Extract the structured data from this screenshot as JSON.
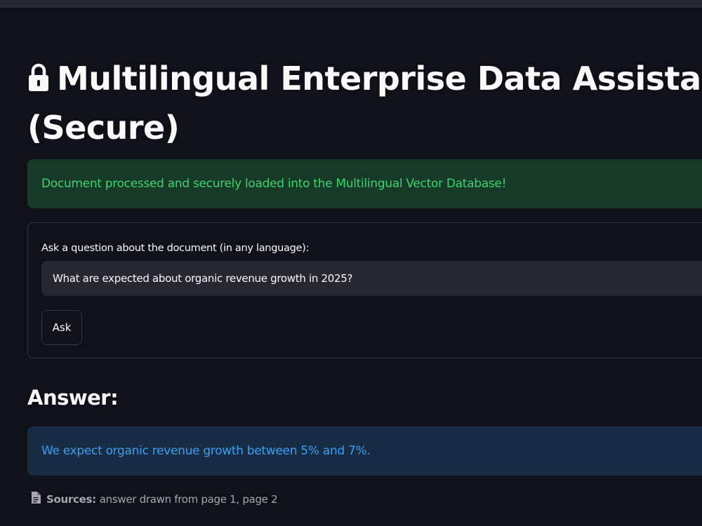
{
  "page": {
    "title": "Multilingual Enterprise Data Assistant (Secure)",
    "title_icon": "lock-icon"
  },
  "alerts": {
    "success": "Document processed and securely loaded into the Multilingual Vector Database!",
    "answer": "We expect organic revenue growth between 5% and 7%."
  },
  "form": {
    "question_label": "Ask a question about the document (in any language):",
    "question_value": "What are expected about organic revenue growth in 2025?",
    "ask_label": "Ask"
  },
  "answer": {
    "heading": "Answer:"
  },
  "sources": {
    "icon": "document-icon",
    "label": "Sources:",
    "text": "answer drawn from page 1, page 2"
  },
  "colors": {
    "background": "#0e1117",
    "success_bg": "#173928",
    "success_text": "#3dd56d",
    "info_bg": "#172d43",
    "info_text": "#3d9df3",
    "input_bg": "#262730"
  }
}
